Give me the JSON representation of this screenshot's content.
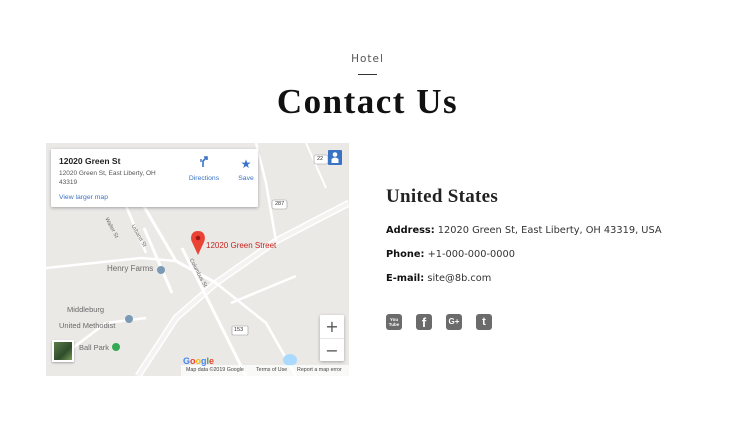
{
  "header": {
    "eyebrow": "Hotel",
    "title": "Contact Us"
  },
  "map": {
    "card": {
      "place_name": "12020 Green St",
      "address": "12020 Green St, East Liberty, OH 43319",
      "directions_label": "Directions",
      "save_label": "Save",
      "larger_map_link": "View larger map"
    },
    "pin_label": "12020 Green Street",
    "labels": {
      "henry_farms": "Henry Farms",
      "middleburg": "Middleburg",
      "united_methodist": "United Methodist",
      "ball_park": "Ball Park",
      "walter_st": "Walter St",
      "urbana_st": "Urbana St",
      "columbus_st": "Columbus St",
      "route_287": "287",
      "route_22": "22",
      "route_153": "153"
    },
    "zoom_in": "+",
    "zoom_out": "−",
    "google_logo": "Google",
    "attribution": {
      "map_data": "Map data ©2019 Google",
      "terms": "Terms of Use",
      "report": "Report a map error"
    }
  },
  "contact": {
    "country": "United States",
    "address_label": "Address:",
    "address_value": "12020 Green St, East Liberty, OH 43319, USA",
    "phone_label": "Phone:",
    "phone_value": "+1-000-000-0000",
    "email_label": "E-mail:",
    "email_value": "site@8b.com"
  },
  "social": {
    "youtube_text": "You Tube",
    "facebook_text": "f",
    "gplus_text": "G+",
    "twitter_text": "t"
  },
  "colors": {
    "map_land": "#ebe9e6",
    "link_blue": "#3a73c4",
    "pin_red": "#c5221f",
    "icon_gray": "#6b6b6b"
  }
}
